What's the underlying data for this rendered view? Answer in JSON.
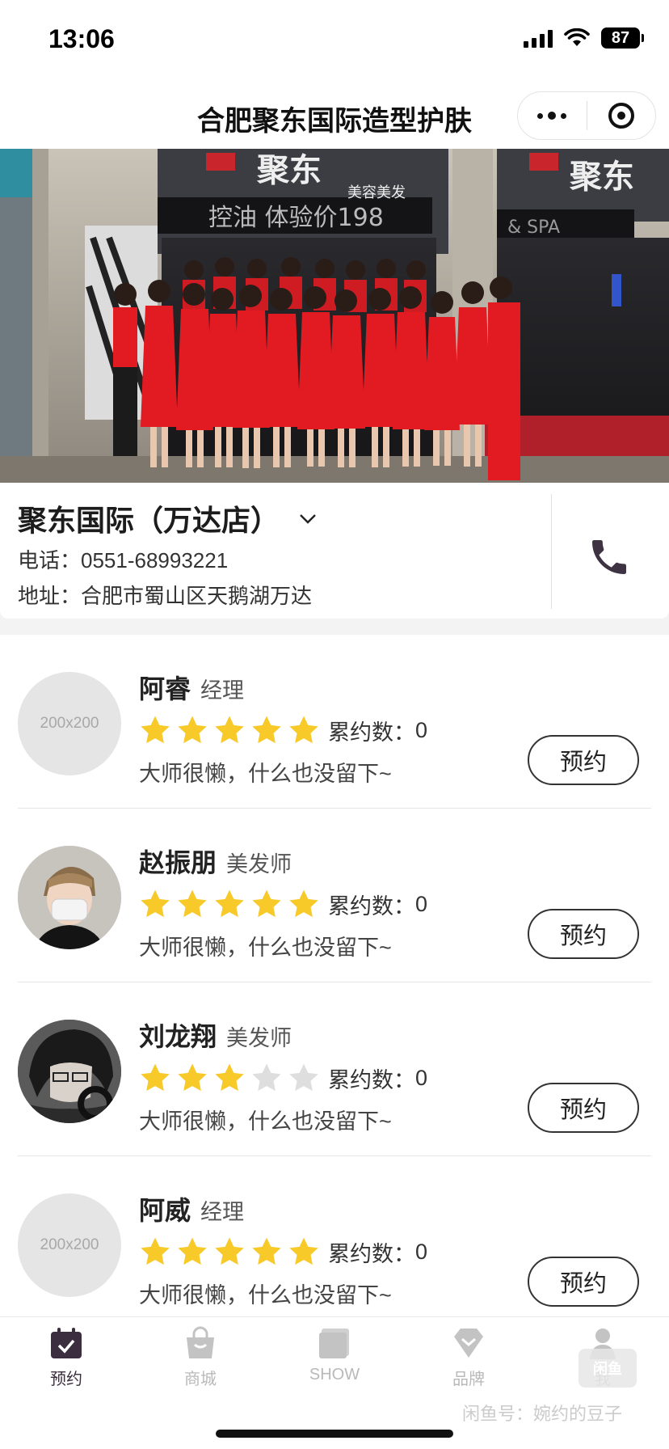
{
  "status_bar": {
    "time": "13:06",
    "battery": "87"
  },
  "nav": {
    "title": "合肥聚东国际造型护肤"
  },
  "hero": {
    "sign_left": "聚东",
    "sign_left_sub": "美容美发",
    "sign_right": "聚东",
    "led_text": "控油 体验价198",
    "spa_text": "& SPA"
  },
  "store": {
    "name": "聚东国际（万达店）",
    "phone": "电话：0551-68993221",
    "address": "地址：合肥市蜀山区天鹅湖万达"
  },
  "stylists": [
    {
      "name": "阿睿",
      "role": "经理",
      "rating": 5,
      "count_label": "累约数：",
      "count": "0",
      "desc": "大师很懒，什么也没留下~",
      "avatar_placeholder": "200x200",
      "button": "预约"
    },
    {
      "name": "赵振朋",
      "role": "美发师",
      "rating": 5,
      "count_label": "累约数：",
      "count": "0",
      "desc": "大师很懒，什么也没留下~",
      "avatar_placeholder": "",
      "button": "预约"
    },
    {
      "name": "刘龙翔",
      "role": "美发师",
      "rating": 3,
      "count_label": "累约数：",
      "count": "0",
      "desc": "大师很懒，什么也没留下~",
      "avatar_placeholder": "",
      "button": "预约"
    },
    {
      "name": "阿威",
      "role": "经理",
      "rating": 5,
      "count_label": "累约数：",
      "count": "0",
      "desc": "大师很懒，什么也没留下~",
      "avatar_placeholder": "200x200",
      "button": "预约"
    }
  ],
  "tabs": [
    {
      "label": "预约",
      "icon": "calendar-check-icon",
      "active": true
    },
    {
      "label": "商城",
      "icon": "shopping-bag-icon",
      "active": false
    },
    {
      "label": "SHOW",
      "icon": "gallery-icon",
      "active": false
    },
    {
      "label": "品牌",
      "icon": "diamond-icon",
      "active": false
    },
    {
      "label": "我",
      "icon": "user-icon",
      "active": false
    }
  ],
  "watermark": {
    "text": "闲鱼号：婉约的豆子",
    "logo": "闲鱼"
  },
  "colors": {
    "star_on": "#f7c929",
    "star_off": "#dedede",
    "active_tab": "#3a2e3f",
    "inactive_tab": "#b9b9b9"
  }
}
